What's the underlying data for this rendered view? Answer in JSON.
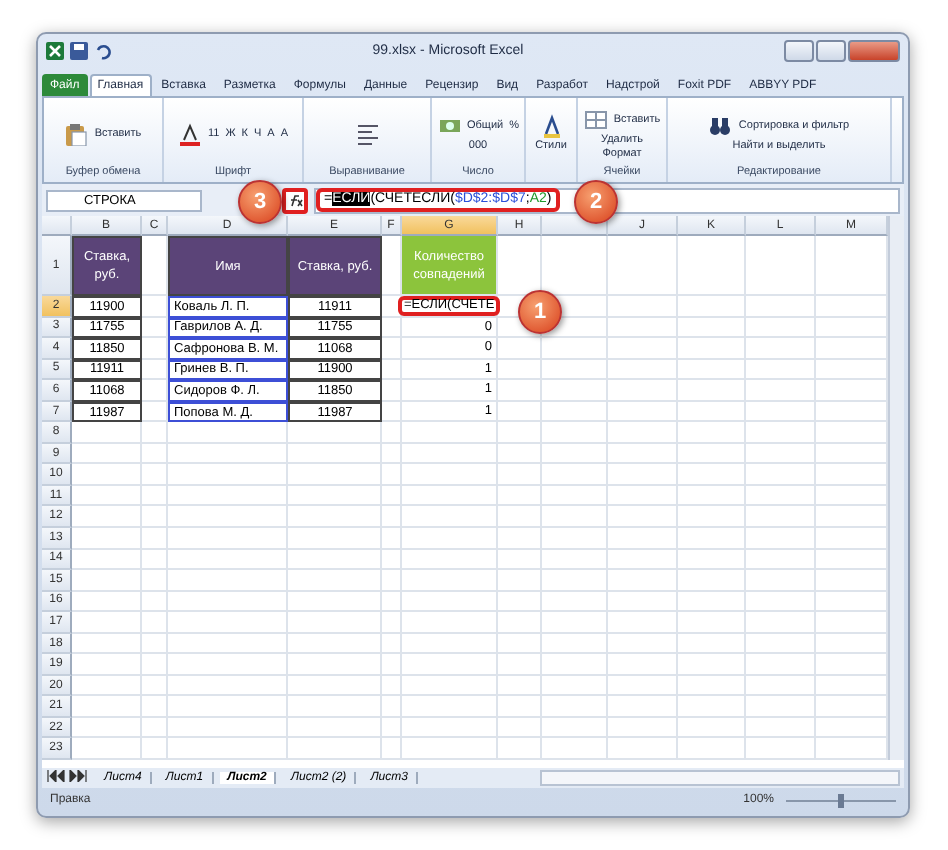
{
  "window": {
    "title": "99.xlsx - Microsoft Excel"
  },
  "ribbon_tabs": [
    {
      "label": "Файл",
      "kind": "file",
      "selected": false
    },
    {
      "label": "Главная",
      "kind": "tab",
      "selected": true
    },
    {
      "label": "Вставка",
      "kind": "tab",
      "selected": false
    },
    {
      "label": "Разметка",
      "kind": "tab",
      "selected": false
    },
    {
      "label": "Формулы",
      "kind": "tab",
      "selected": false
    },
    {
      "label": "Данные",
      "kind": "tab",
      "selected": false
    },
    {
      "label": "Рецензир",
      "kind": "tab",
      "selected": false
    },
    {
      "label": "Вид",
      "kind": "tab",
      "selected": false
    },
    {
      "label": "Разработ",
      "kind": "tab",
      "selected": false
    },
    {
      "label": "Надстрой",
      "kind": "tab",
      "selected": false
    },
    {
      "label": "Foxit PDF",
      "kind": "tab",
      "selected": false
    },
    {
      "label": "ABBYY PDF",
      "kind": "tab",
      "selected": false
    }
  ],
  "ribbon_groups": [
    {
      "label": "Буфер обмена",
      "kind": "clipboard",
      "items": [
        "Вставить"
      ]
    },
    {
      "label": "Шрифт",
      "kind": "font",
      "items": [
        "11",
        "Ж",
        "К",
        "Ч",
        "A",
        "A"
      ]
    },
    {
      "label": "Выравнивание",
      "kind": "align"
    },
    {
      "label": "Число",
      "kind": "number",
      "items": [
        "Общий",
        "%",
        "000"
      ]
    },
    {
      "kind": "styles",
      "items": [
        "Стили"
      ]
    },
    {
      "label": "Ячейки",
      "kind": "cells",
      "items": [
        "Вставить",
        "Удалить",
        "Формат"
      ]
    },
    {
      "label": "Редактирование",
      "kind": "edit",
      "items": [
        "Сортировка и фильтр",
        "Найти и выделить"
      ]
    }
  ],
  "formula_bar": {
    "name_box": "СТРОКА",
    "formula": [
      {
        "text": "=",
        "kind": "plain"
      },
      {
        "text": "ЕСЛИ",
        "kind": "selected"
      },
      {
        "text": "(СЧЕТЕСЛИ(",
        "kind": "plain"
      },
      {
        "text": "$D$2:$D$7",
        "kind": "ref1"
      },
      {
        "text": ";",
        "kind": "plain"
      },
      {
        "text": "A2",
        "kind": "ref2"
      },
      {
        "text": ")",
        "kind": "plain"
      }
    ]
  },
  "columns": [
    {
      "label": "B",
      "selected": false
    },
    {
      "label": "C",
      "selected": false
    },
    {
      "label": "D",
      "selected": false
    },
    {
      "label": "E",
      "selected": false
    },
    {
      "label": "F",
      "selected": false
    },
    {
      "label": "G",
      "selected": true
    },
    {
      "label": "H",
      "selected": false
    },
    {
      "selected": false
    },
    {
      "label": "J",
      "selected": false
    },
    {
      "label": "K",
      "selected": false
    },
    {
      "label": "L",
      "selected": false
    },
    {
      "label": "M",
      "selected": false
    }
  ],
  "header_row": {
    "number": "1",
    "b": "Ставка, руб.",
    "d": "Имя",
    "e": "Ставка, руб.",
    "g": "Количество совпадений"
  },
  "rows": [
    {
      "number": "2",
      "selected": true,
      "referenced": true,
      "b": "11900",
      "d": "Коваль Л. П.",
      "e": "11911",
      "g": "=ЕСЛИ(СЧЕТЕ"
    },
    {
      "number": "3",
      "selected": false,
      "referenced": true,
      "b": "11755",
      "d": "Гаврилов А. Д.",
      "e": "11755",
      "g": "0"
    },
    {
      "number": "4",
      "selected": false,
      "referenced": true,
      "b": "11850",
      "d": "Сафронова В. М.",
      "e": "11068",
      "g": "0"
    },
    {
      "number": "5",
      "selected": false,
      "referenced": true,
      "b": "11911",
      "d": "Гринев В. П.",
      "e": "11900",
      "g": "1"
    },
    {
      "number": "6",
      "selected": false,
      "referenced": true,
      "b": "11068",
      "d": "Сидоров Ф. Л.",
      "e": "11850",
      "g": "1"
    },
    {
      "number": "7",
      "selected": false,
      "referenced": true,
      "b": "11987",
      "d": "Попова М. Д.",
      "e": "11987",
      "g": "1"
    },
    {
      "number": "8",
      "selected": false,
      "referenced": false
    },
    {
      "number": "9",
      "selected": false,
      "referenced": false
    },
    {
      "number": "10",
      "selected": false,
      "referenced": false
    },
    {
      "number": "11",
      "selected": false,
      "referenced": false
    },
    {
      "number": "12",
      "selected": false,
      "referenced": false
    },
    {
      "number": "13",
      "selected": false,
      "referenced": false
    },
    {
      "number": "14",
      "selected": false,
      "referenced": false
    },
    {
      "number": "15",
      "selected": false,
      "referenced": false
    },
    {
      "number": "16",
      "selected": false,
      "referenced": false
    },
    {
      "number": "17",
      "selected": false,
      "referenced": false
    },
    {
      "number": "18",
      "selected": false,
      "referenced": false
    },
    {
      "number": "19",
      "selected": false,
      "referenced": false
    },
    {
      "number": "20",
      "selected": false,
      "referenced": false
    },
    {
      "number": "21",
      "selected": false,
      "referenced": false
    },
    {
      "number": "22",
      "selected": false,
      "referenced": false
    },
    {
      "number": "23",
      "selected": false,
      "referenced": false
    }
  ],
  "callouts": [
    {
      "label": "3"
    },
    {
      "label": "2"
    },
    {
      "label": "1"
    }
  ],
  "sheet_tabs": [
    {
      "label": "Лист4",
      "selected": false
    },
    {
      "label": "Лист1",
      "selected": false
    },
    {
      "label": "Лист2",
      "selected": true
    },
    {
      "label": "Лист2 (2)",
      "selected": false
    },
    {
      "label": "Лист3",
      "selected": false
    }
  ],
  "status_bar": {
    "mode": "Правка",
    "zoom": "100%",
    "zoom_level": {
      "level": 0.5
    }
  }
}
